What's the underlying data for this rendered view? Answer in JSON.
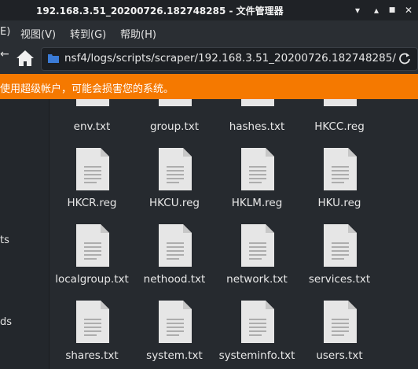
{
  "window": {
    "title": "192.168.3.51_20200726.182748285 - 文件管理器",
    "controls": [
      "▾",
      "▴",
      "■",
      "✕"
    ]
  },
  "menubar": {
    "items": [
      "E)",
      "视图(V)",
      "转到(G)",
      "帮助(H)"
    ]
  },
  "toolbar": {
    "left_truncated": "←",
    "path": "nsf4/logs/scripts/scraper/192.168.3.51_20200726.182748285/"
  },
  "warning": {
    "text": "使用超级帐户，可能会损害您的系统。"
  },
  "sidebar": {
    "items": [
      "ts",
      "ds"
    ]
  },
  "files": [
    {
      "name": "env.txt"
    },
    {
      "name": "group.txt"
    },
    {
      "name": "hashes.txt"
    },
    {
      "name": "HKCC.reg"
    },
    {
      "name": "HKCR.reg"
    },
    {
      "name": "HKCU.reg"
    },
    {
      "name": "HKLM.reg"
    },
    {
      "name": "HKU.reg"
    },
    {
      "name": "localgroup.txt"
    },
    {
      "name": "nethood.txt"
    },
    {
      "name": "network.txt"
    },
    {
      "name": "services.txt"
    },
    {
      "name": "shares.txt"
    },
    {
      "name": "system.txt"
    },
    {
      "name": "systeminfo.txt"
    },
    {
      "name": "users.txt"
    }
  ]
}
